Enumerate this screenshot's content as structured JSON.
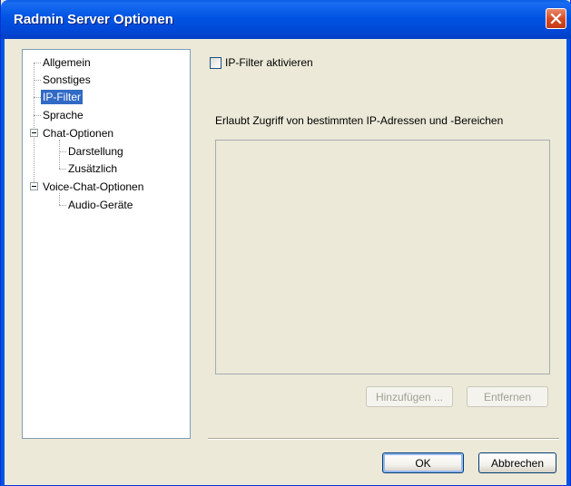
{
  "window": {
    "title": "Radmin Server Optionen"
  },
  "tree": {
    "items": [
      {
        "label": "Allgemein"
      },
      {
        "label": "Sonstiges"
      },
      {
        "label": "IP-Filter"
      },
      {
        "label": "Sprache"
      },
      {
        "label": "Chat-Optionen"
      },
      {
        "label": "Darstellung"
      },
      {
        "label": "Zusätzlich"
      },
      {
        "label": "Voice-Chat-Optionen"
      },
      {
        "label": "Audio-Geräte"
      }
    ],
    "selected": "IP-Filter"
  },
  "ip_filter": {
    "checkbox_label": "IP-Filter aktivieren",
    "checked": false,
    "info_label": "Erlaubt Zugriff von bestimmten IP-Adressen und -Bereichen",
    "add_label": "Hinzufügen ...",
    "remove_label": "Entfernen"
  },
  "footer": {
    "ok_label": "OK",
    "cancel_label": "Abbrechen"
  },
  "colors": {
    "titlebar": "#0054E3",
    "selection": "#316AC5",
    "close": "#D74C26"
  },
  "icons": {
    "close": "close-icon",
    "expander": "minus-expander-icon"
  }
}
